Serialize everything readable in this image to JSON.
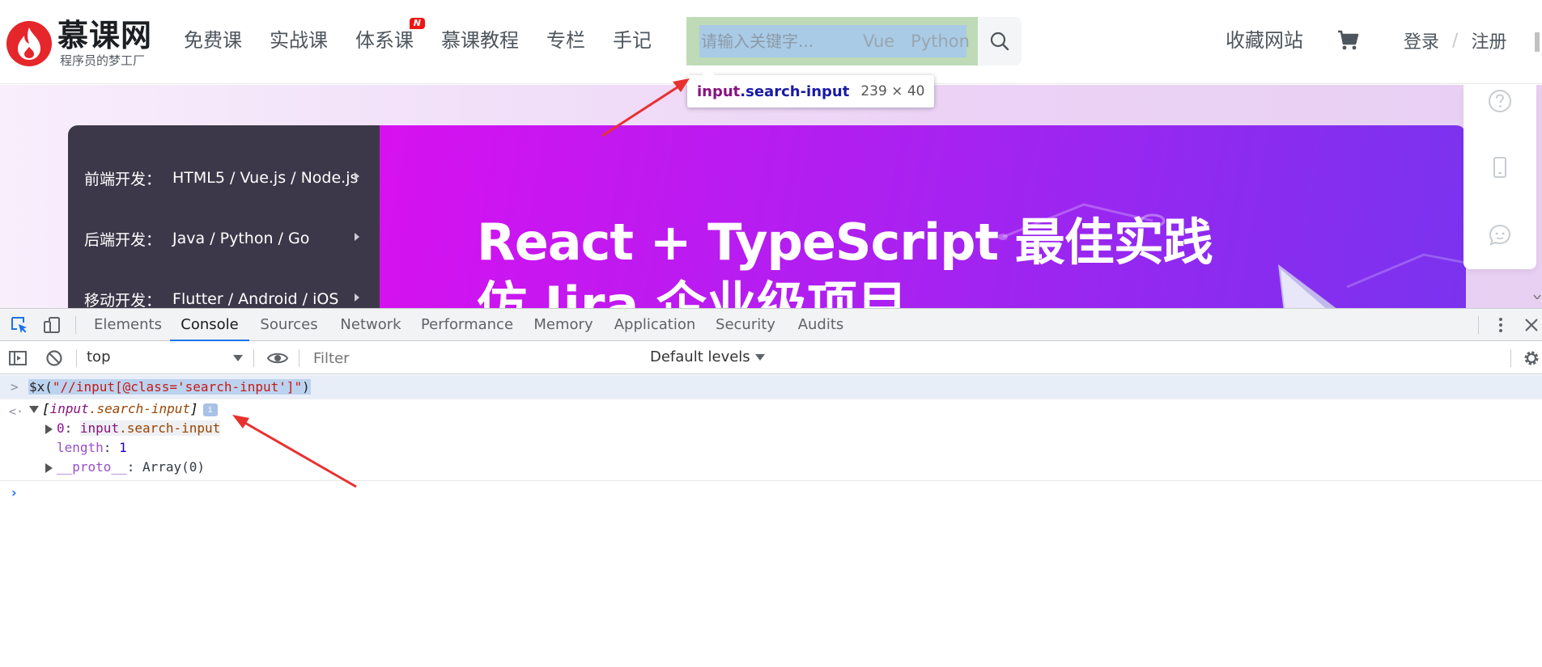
{
  "site": {
    "logo_name": "慕课网",
    "logo_slogan": "程序员的梦工厂",
    "nav": [
      {
        "label": "免费课"
      },
      {
        "label": "实战课"
      },
      {
        "label": "体系课",
        "badge": "N"
      },
      {
        "label": "慕课教程"
      },
      {
        "label": "专栏"
      },
      {
        "label": "手记"
      }
    ],
    "search": {
      "placeholder": "请输入关键字...",
      "hot_tags": [
        "Vue",
        "Python"
      ]
    },
    "favorite": "收藏网站",
    "login": "登录",
    "divider": "/",
    "register": "注册"
  },
  "inspect_tooltip": {
    "tag": "input",
    "class": ".search-input",
    "size": "239 × 40"
  },
  "banner": {
    "categories": [
      {
        "title": "前端开发：",
        "items": "HTML5 / Vue.js / Node.js"
      },
      {
        "title": "后端开发：",
        "items": "Java / Python / Go"
      },
      {
        "title": "移动开发：",
        "items": "Flutter / Android / iOS"
      }
    ],
    "hero_title": "React + TypeScript 最佳实践",
    "hero_subtitle": "仿 Jira 企业级项目",
    "hero_colors": [
      "#d711f0",
      "#8a2cf0"
    ]
  },
  "side_tools": [
    "help-icon",
    "mobile-icon",
    "chat-icon"
  ],
  "devtools": {
    "tabs": [
      "Elements",
      "Console",
      "Sources",
      "Network",
      "Performance",
      "Memory",
      "Application",
      "Security",
      "Audits"
    ],
    "active_tab": "Console",
    "context": "top",
    "filter_placeholder": "Filter",
    "levels": "Default levels",
    "console": {
      "command_prefix": "$x(",
      "command_string": "\"//input[@class='search-input']\"",
      "command_suffix": ")",
      "result_open": "[",
      "result_tag": "input",
      "result_class": ".search-input",
      "result_close": "]",
      "info_badge": "i",
      "entry_index": "0",
      "entry_sep": ": ",
      "entry_tag": "input",
      "entry_class": ".search-input",
      "length_key": "length",
      "length_sep": ": ",
      "length_value": "1",
      "proto_key": "__proto__",
      "proto_sep": ": ",
      "proto_value": "Array(0)"
    }
  },
  "colors": {
    "brand_red": "#e5262a",
    "devtools_accent": "#1a73e8",
    "annotation_arrow": "#e8312f",
    "search_highlight": "#a9cbe6"
  }
}
